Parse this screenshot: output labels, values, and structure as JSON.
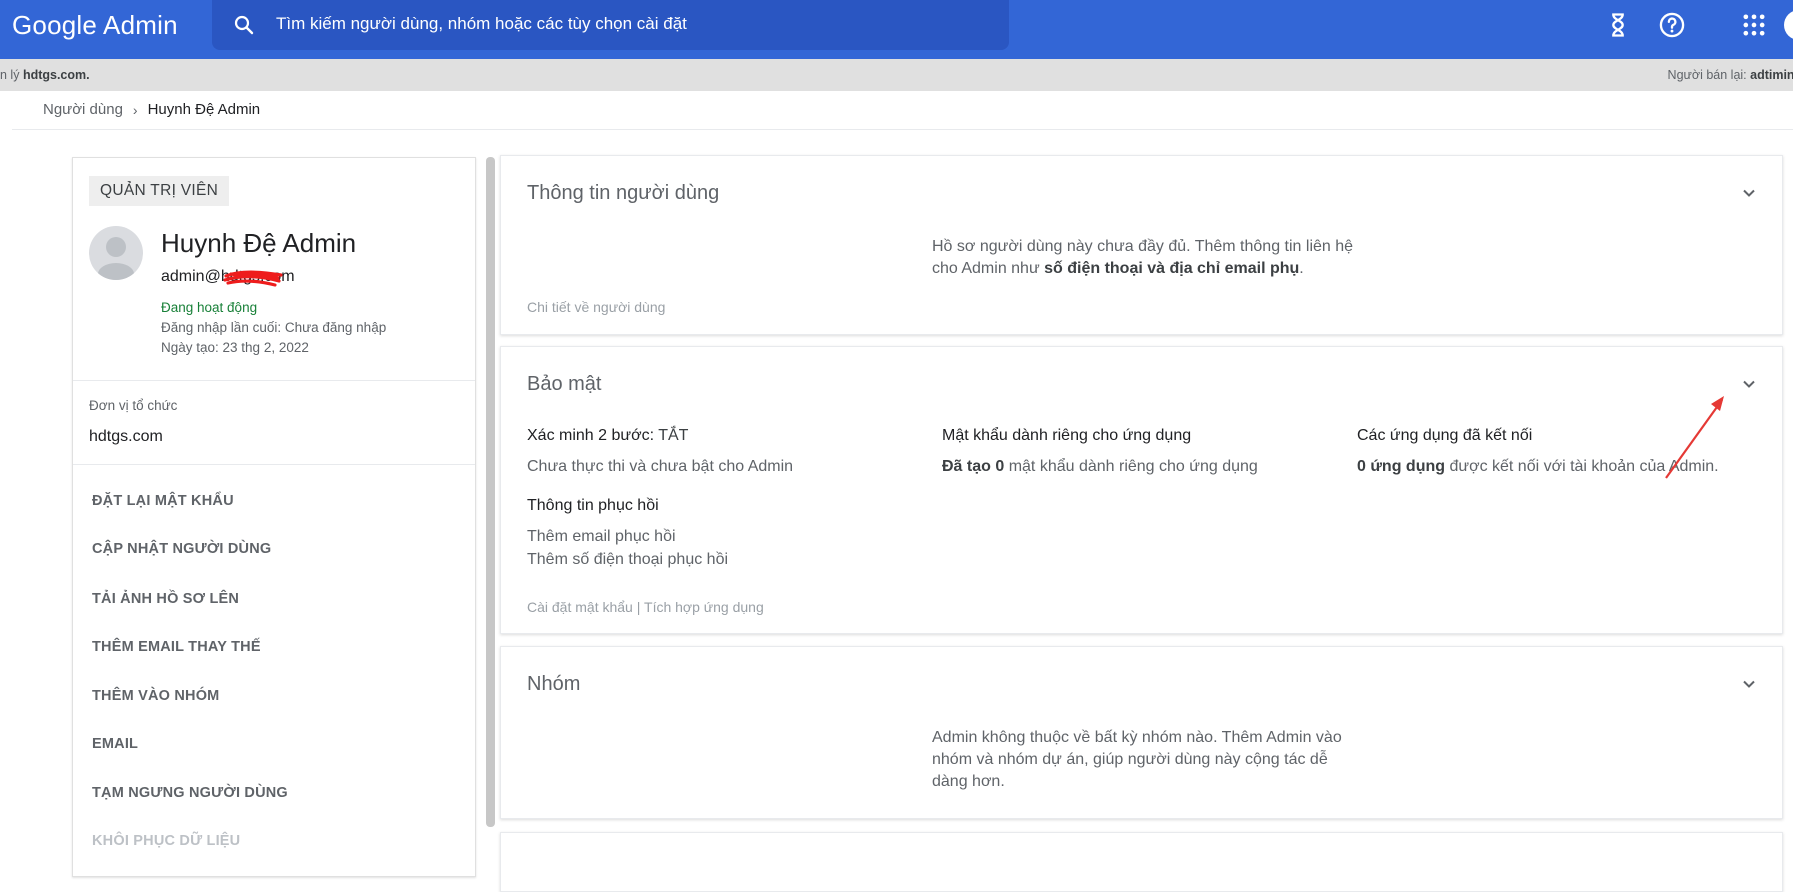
{
  "header": {
    "logo": "Google Admin",
    "search_placeholder": "Tìm kiếm người dùng, nhóm hoặc các tùy chọn cài đặt"
  },
  "graybar": {
    "left_prefix": "n lý ",
    "left_domain": "hdtgs.com.",
    "right_prefix": "Người bán lại: ",
    "right_value": "adtimin.c"
  },
  "breadcrumb": {
    "parent": "Người dùng",
    "current": "Huynh Đệ Admin"
  },
  "profile": {
    "role": "QUẢN TRỊ VIÊN",
    "name": "Huynh Đệ Admin",
    "email": "admin@hdtgs.com",
    "status": "Đang hoạt động",
    "last_login": "Đăng nhập lần cuối: Chưa đăng nhập",
    "created": "Ngày tạo: 23 thg 2, 2022",
    "org_label": "Đơn vị tổ chức",
    "org_value": "hdtgs.com"
  },
  "actions": [
    "ĐẶT LẠI MẬT KHẨU",
    "CẬP NHẬT NGƯỜI DÙNG",
    "TẢI ẢNH HỒ SƠ LÊN",
    "THÊM EMAIL THAY THẾ",
    "THÊM VÀO NHÓM",
    "EMAIL",
    "TẠM NGƯNG NGƯỜI DÙNG",
    "KHÔI PHỤC DỮ LIỆU"
  ],
  "user_info_card": {
    "title": "Thông tin người dùng",
    "text_1": "Hồ sơ người dùng này chưa đầy đủ. Thêm thông tin liên hệ",
    "text_2_prefix": "cho Admin như ",
    "text_2_bold": "số điện thoại và địa chỉ email phụ",
    "text_2_suffix": ".",
    "link": "Chi tiết về người dùng"
  },
  "security_card": {
    "title": "Bảo mật",
    "two_step_label": "Xác minh 2 bước: ",
    "two_step_value": "TẮT",
    "two_step_desc": "Chưa thực thi và chưa bật cho Admin",
    "app_pw_title": "Mật khẩu dành riêng cho ứng dụng",
    "app_pw_bold": "Đã tạo 0",
    "app_pw_desc": " mật khẩu dành riêng cho ứng dụng",
    "connected_title": "Các ứng dụng đã kết nối",
    "connected_bold": "0 ứng dụng",
    "connected_desc": " được kết nối với tài khoản của Admin.",
    "recovery_title": "Thông tin phục hồi",
    "recovery_email": "Thêm email phục hồi",
    "recovery_phone": "Thêm số điện thoại phục hồi",
    "link_password": "Cài đặt mật khẩu",
    "link_sep": " | ",
    "link_apps": "Tích hợp ứng dụng"
  },
  "groups_card": {
    "title": "Nhóm",
    "text_1": "Admin không thuộc về bất kỳ nhóm nào. Thêm Admin vào",
    "text_2": "nhóm và nhóm dự án, giúp người dùng này cộng tác dễ",
    "text_3": "dàng hơn."
  },
  "colors": {
    "topbar": "#3366d6",
    "search": "#2a56c2",
    "status_green": "#188038",
    "annotation_red": "#e53935"
  },
  "icons": [
    "search-icon",
    "hourglass-icon",
    "help-icon",
    "apps-grid-icon",
    "chevron-down-icon",
    "default-avatar-icon"
  ]
}
